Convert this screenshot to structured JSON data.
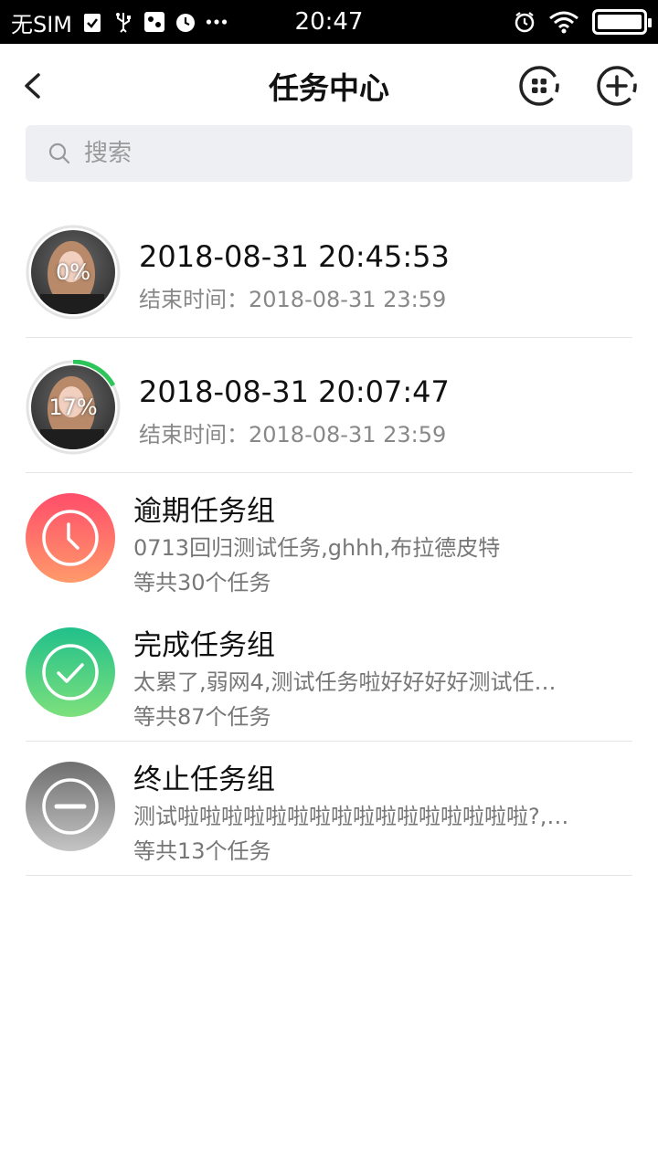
{
  "status_bar": {
    "carrier": "无SIM",
    "time": "20:47",
    "icons": [
      "checklist-icon",
      "usb-icon",
      "debug-icon",
      "alarm-icon",
      "more-icon",
      "alarm-icon",
      "wifi-icon",
      "battery-icon"
    ]
  },
  "nav": {
    "title": "任务中心",
    "back_icon": "chevron-left-icon",
    "grid_icon": "grid-icon",
    "add_icon": "plus-circle-icon"
  },
  "search": {
    "placeholder": "搜索"
  },
  "tasks": [
    {
      "title": "2018-08-31 20:45:53",
      "end_label": "结束时间：",
      "end_time": "2018-08-31 23:59",
      "progress_text": "0%",
      "progress": 0.0
    },
    {
      "title": "2018-08-31 20:07:47",
      "end_label": "结束时间：",
      "end_time": "2018-08-31 23:59",
      "progress_text": "17%",
      "progress": 0.17
    }
  ],
  "groups": [
    {
      "title": "逾期任务组",
      "desc": "0713回归测试任务,ghhh,布拉德皮特",
      "count": "等共30个任务",
      "icon": "clock-icon",
      "color_start": "#ff4d6a",
      "color_end": "#ff9a6a"
    },
    {
      "title": "完成任务组",
      "desc": "太累了,弱网4,测试任务啦好好好好测试任…",
      "count": "等共87个任务",
      "icon": "check-circle-icon",
      "color_start": "#21c08b",
      "color_end": "#7de07c"
    },
    {
      "title": "终止任务组",
      "desc": "测试啦啦啦啦啦啦啦啦啦啦啦啦啦啦啦啦?,…",
      "count": "等共13个任务",
      "icon": "minus-circle-icon",
      "color_start": "#6f6f6f",
      "color_end": "#c4c4c4"
    }
  ],
  "colors": {
    "progress": "#2dc45a",
    "ring_bg": "#e3e3e3"
  }
}
